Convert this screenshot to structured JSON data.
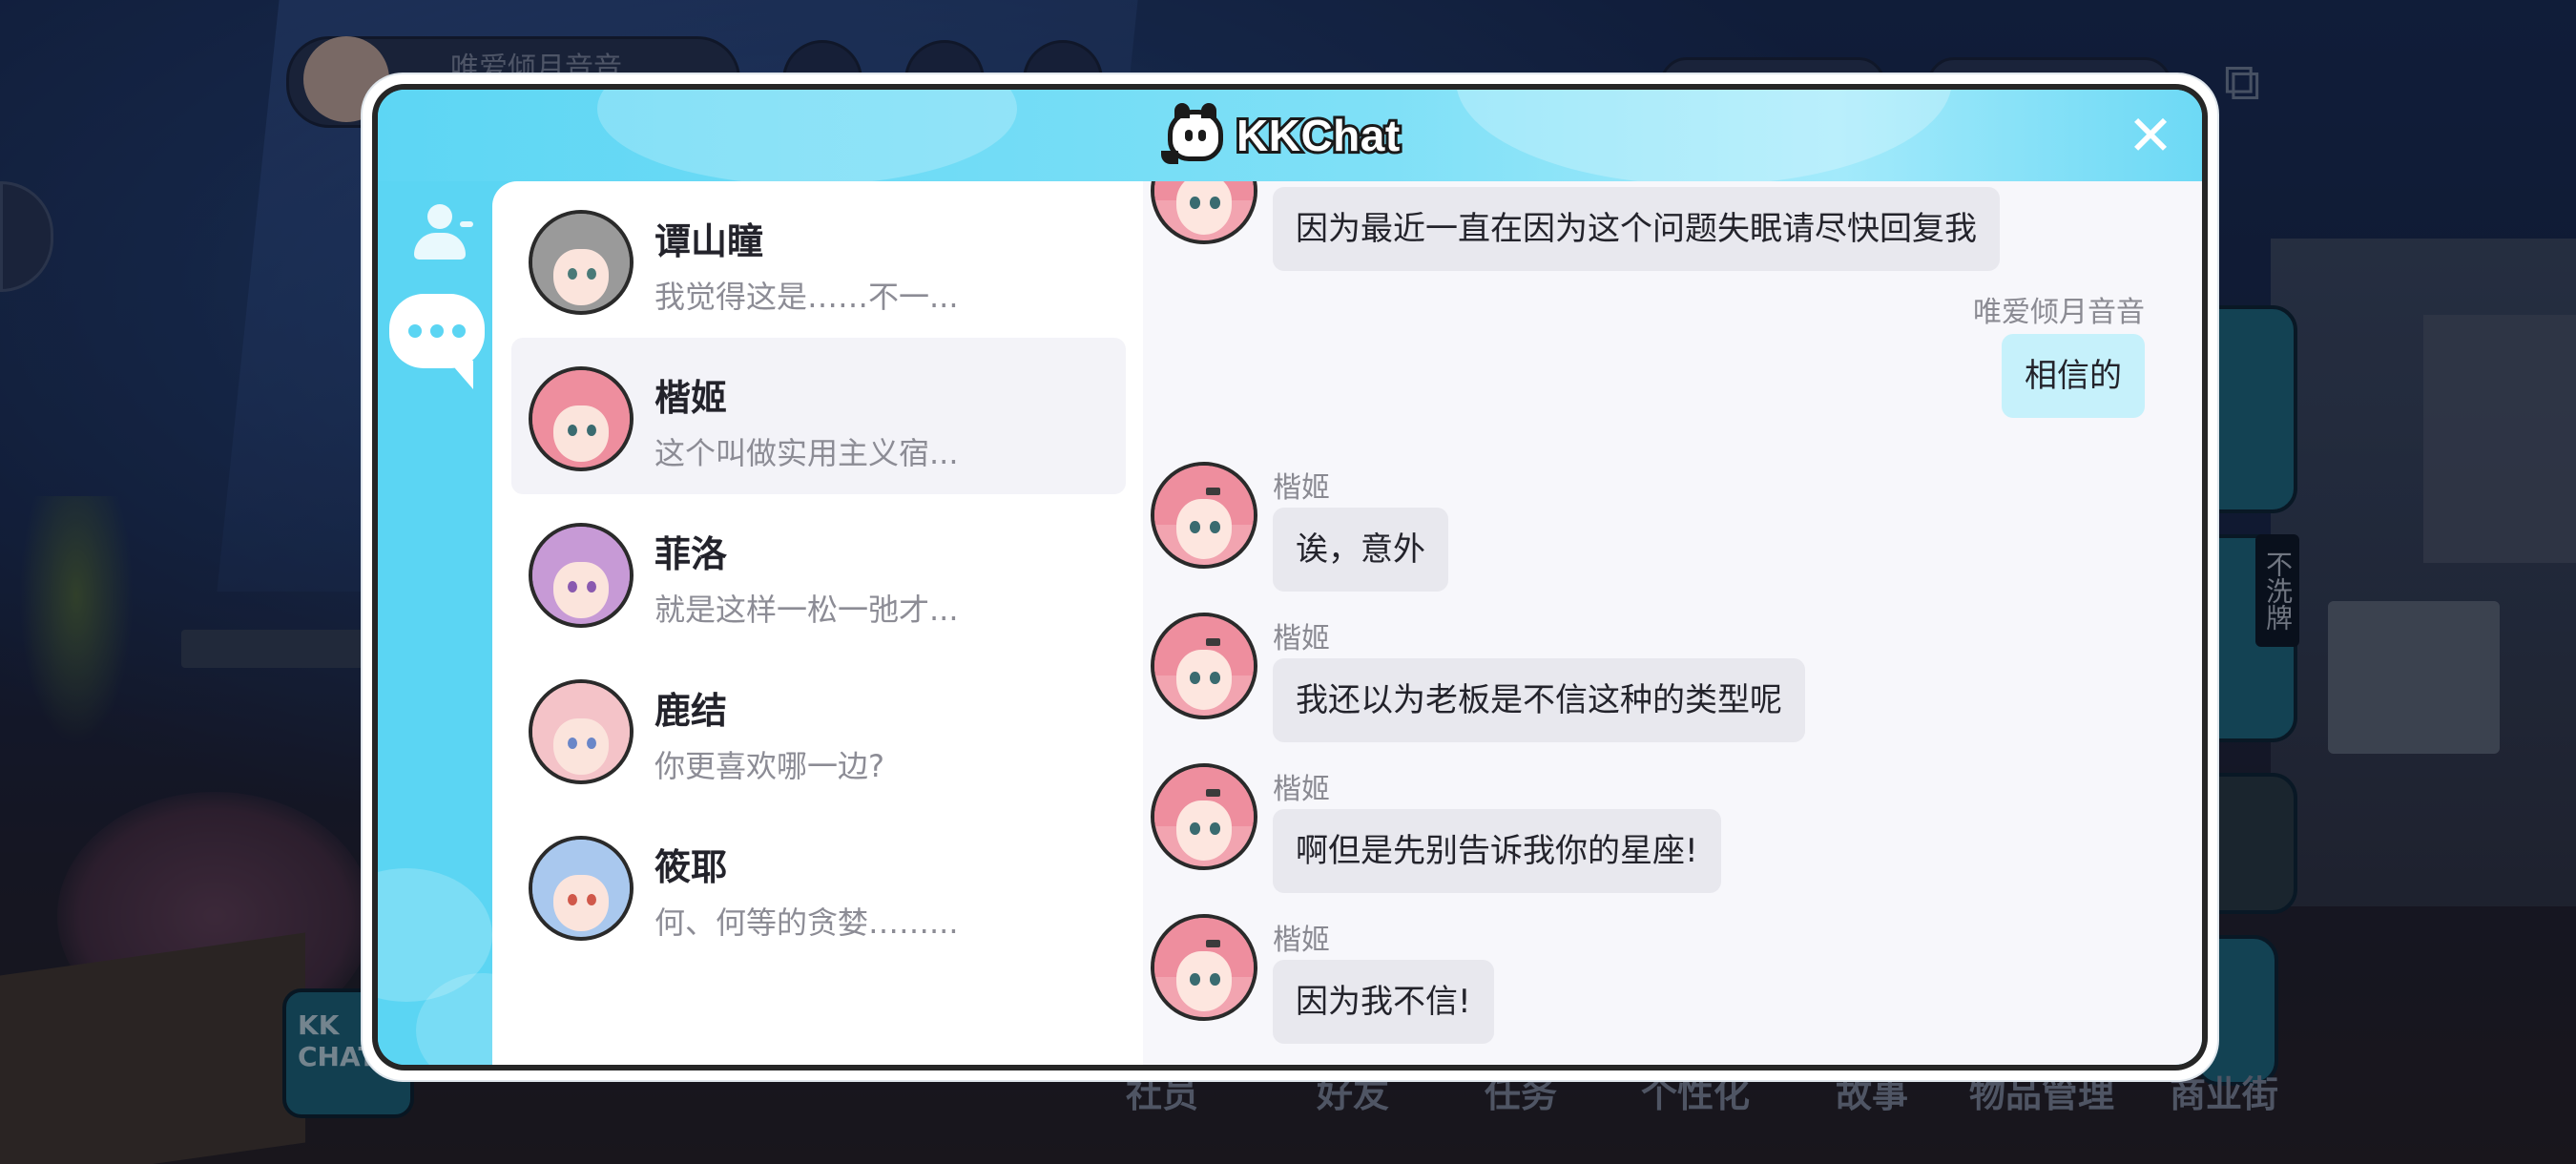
{
  "background": {
    "top_player_name": "唯爱倾月音音",
    "side_badge_text": "不洗牌",
    "kk_logo_text": "KK CHAT",
    "bottom_nav": [
      "社员",
      "好友",
      "任务",
      "个性化",
      "故事",
      "物品管理",
      "商业街"
    ]
  },
  "dialog": {
    "title": "KKChat",
    "close_icon": "close-icon",
    "rail": {
      "contacts_icon": "person-icon",
      "chats_icon": "chat-bubble-icon"
    },
    "contacts": [
      {
        "name": "谭山瞳",
        "preview": "我觉得这是……不一...",
        "active": false,
        "hair": "#9a9a9a",
        "eye": "#4a7a78"
      },
      {
        "name": "楷姬",
        "preview": "这个叫做实用主义宿...",
        "active": true,
        "hair": "#ee8e9e",
        "eye": "#3a6b70"
      },
      {
        "name": "菲洛",
        "preview": "就是这样一松一弛才...",
        "active": false,
        "hair": "#c79ad6",
        "eye": "#8a5ab0"
      },
      {
        "name": "鹿结",
        "preview": "你更喜欢哪一边?",
        "active": false,
        "hair": "#f4c3c8",
        "eye": "#6a86c8"
      },
      {
        "name": "筱耶",
        "preview": "何、何等的贪婪……...",
        "active": false,
        "hair": "#a9c8ee",
        "eye": "#d0584a"
      }
    ],
    "messages": [
      {
        "from": "楷姬",
        "mine": false,
        "show_sender": false,
        "text": "因为最近一直在因为这个问题失眠请尽快回复我"
      },
      {
        "from": "唯爱倾月音音",
        "mine": true,
        "show_sender": true,
        "text": "相信的"
      },
      {
        "from": "楷姬",
        "mine": false,
        "show_sender": true,
        "text": "诶，意外"
      },
      {
        "from": "楷姬",
        "mine": false,
        "show_sender": true,
        "text": "我还以为老板是不信这种的类型呢"
      },
      {
        "from": "楷姬",
        "mine": false,
        "show_sender": true,
        "text": "啊但是先别告诉我你的星座!"
      },
      {
        "from": "楷姬",
        "mine": false,
        "show_sender": true,
        "text": "因为我不信!"
      }
    ]
  },
  "colors": {
    "header": "#5dd6f4",
    "my_bubble": "#c6f1fb",
    "their_bubble": "#e8e8ee",
    "active_contact": "#f3f3f8"
  }
}
